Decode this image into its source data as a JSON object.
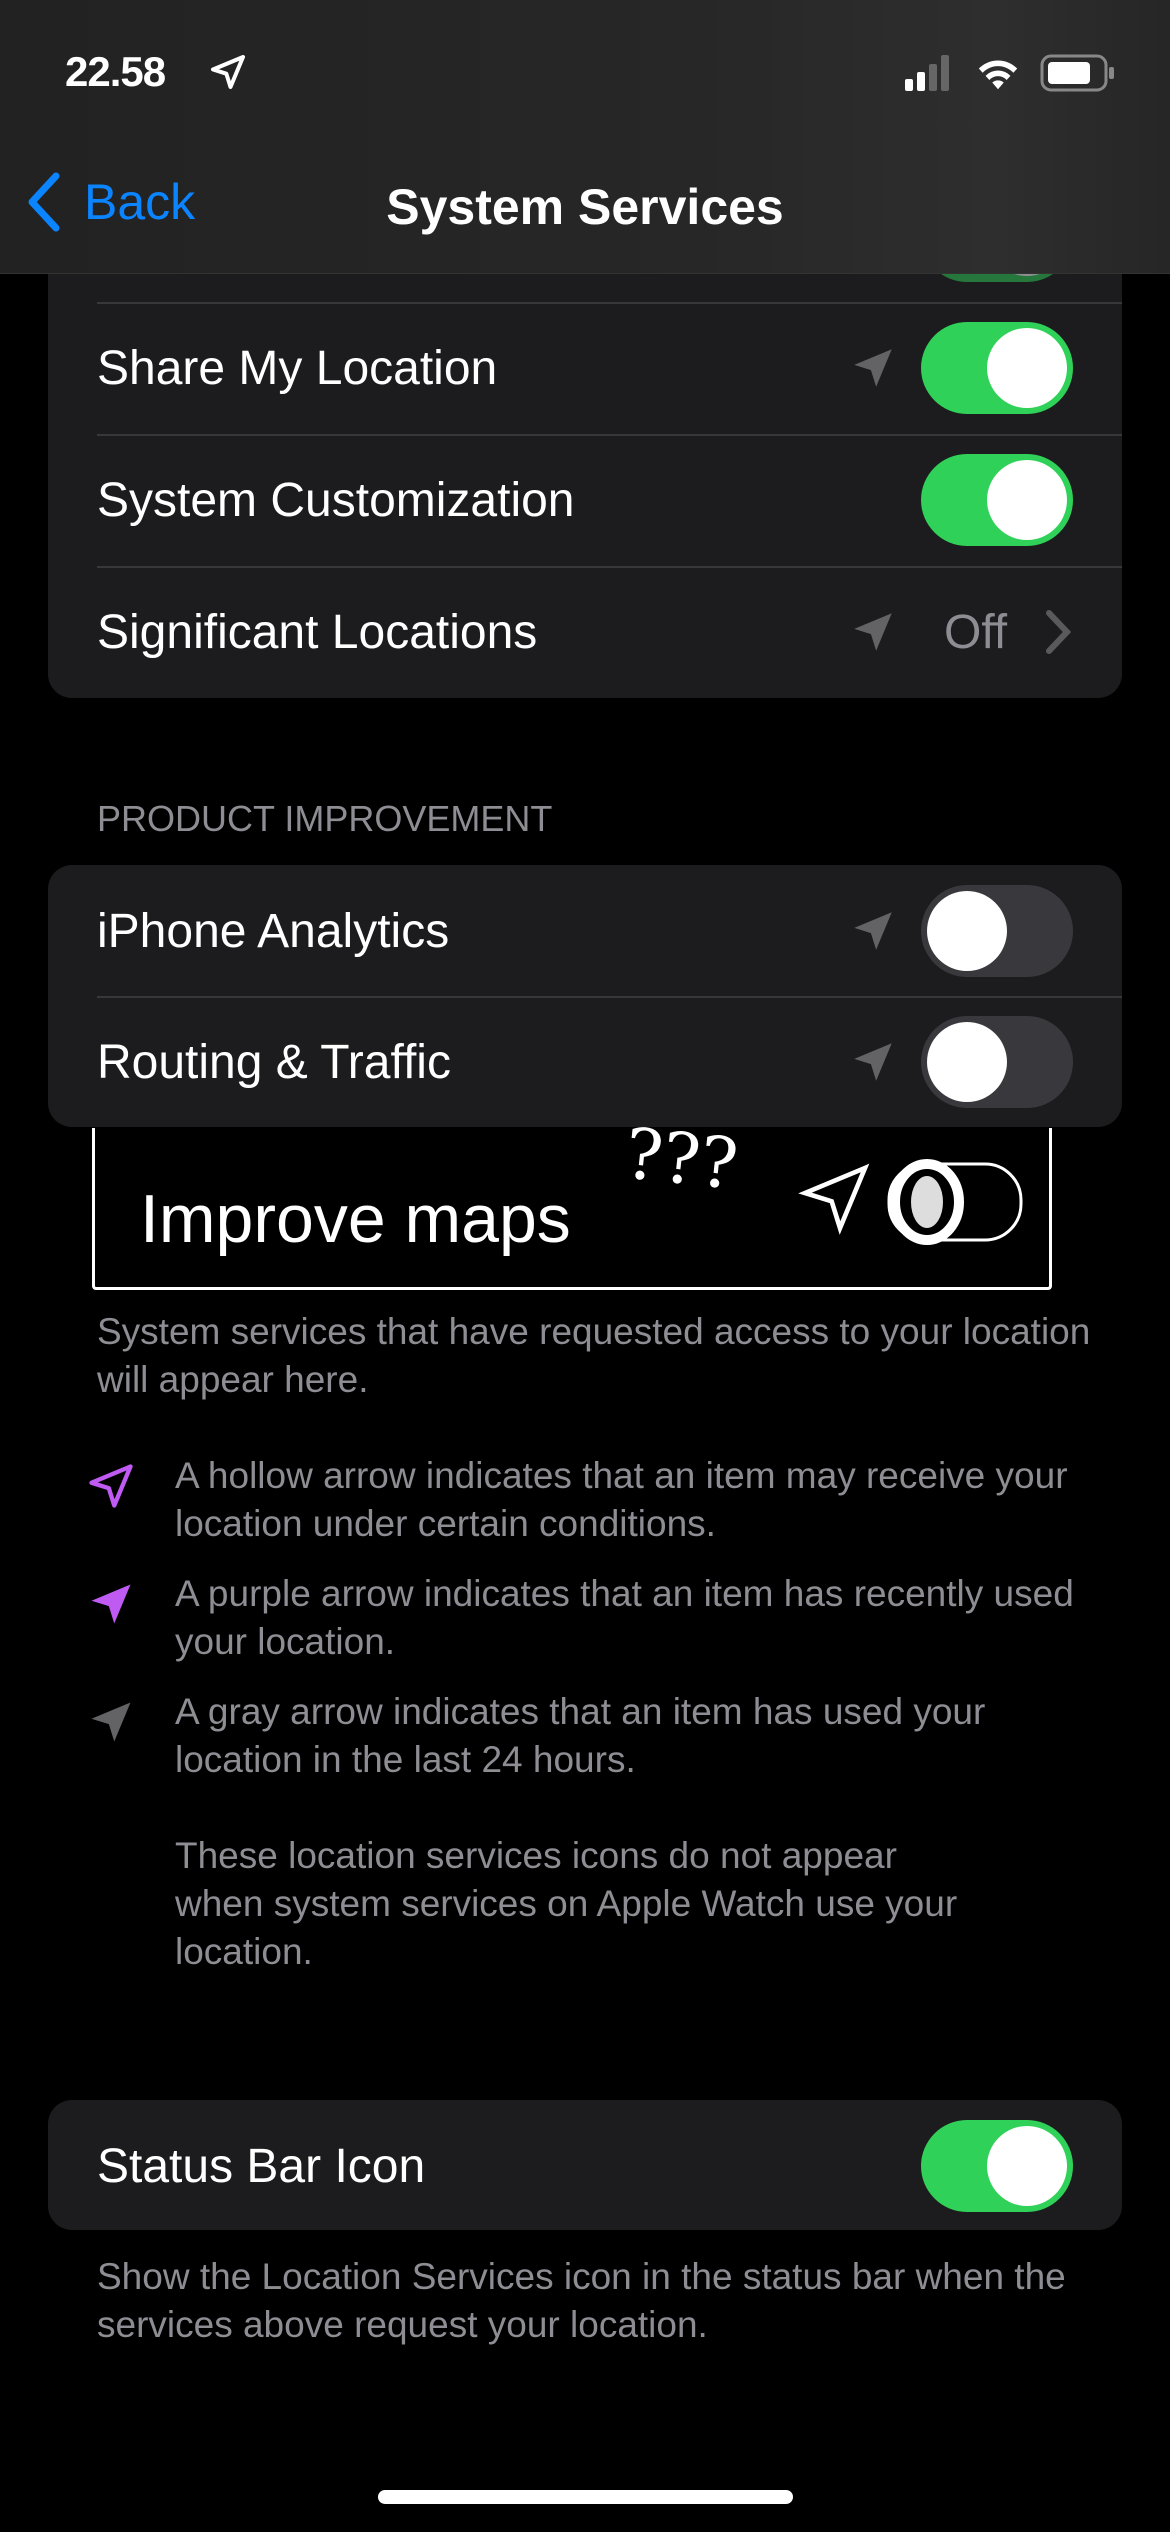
{
  "status_bar": {
    "time": "22.58",
    "location_icon": "location-arrow-icon",
    "signal": "signal-icon",
    "wifi": "wifi-icon",
    "battery": "battery-icon"
  },
  "nav": {
    "back_label": "Back",
    "title": "System Services"
  },
  "colors": {
    "accent": "#0a84ff",
    "toggle_on": "#30d158",
    "location_purple": "#bf5af2",
    "location_gray": "#636366"
  },
  "group1": {
    "rows": [
      {
        "label": "Share My Location",
        "location_icon": "gray",
        "toggle": true
      },
      {
        "label": "System Customization",
        "toggle": true
      },
      {
        "label": "Significant Locations",
        "location_icon": "gray",
        "value": "Off"
      }
    ]
  },
  "product_improvement": {
    "header": "PRODUCT IMPROVEMENT",
    "rows": [
      {
        "label": "iPhone Analytics",
        "location_icon": "gray",
        "toggle": false
      },
      {
        "label": "Routing & Traffic",
        "location_icon": "gray",
        "toggle": false
      }
    ]
  },
  "annotation": {
    "text": "Improve maps",
    "marks": "???"
  },
  "footer1": "System services that have requested access to your location will appear here.",
  "legend": [
    {
      "icon": "hollow-arrow",
      "text": "A hollow arrow indicates that an item may receive your location under certain conditions."
    },
    {
      "icon": "purple-arrow",
      "text": "A purple arrow indicates that an item has recently used your location."
    },
    {
      "icon": "gray-arrow",
      "text": "A gray arrow indicates that an item has used your location in the last 24 hours."
    }
  ],
  "watch_note": "These location services icons do not appear when system services on Apple Watch use your location.",
  "status_bar_icon": {
    "label": "Status Bar Icon",
    "toggle": true,
    "footer": "Show the Location Services icon in the status bar when the services above request your location."
  }
}
